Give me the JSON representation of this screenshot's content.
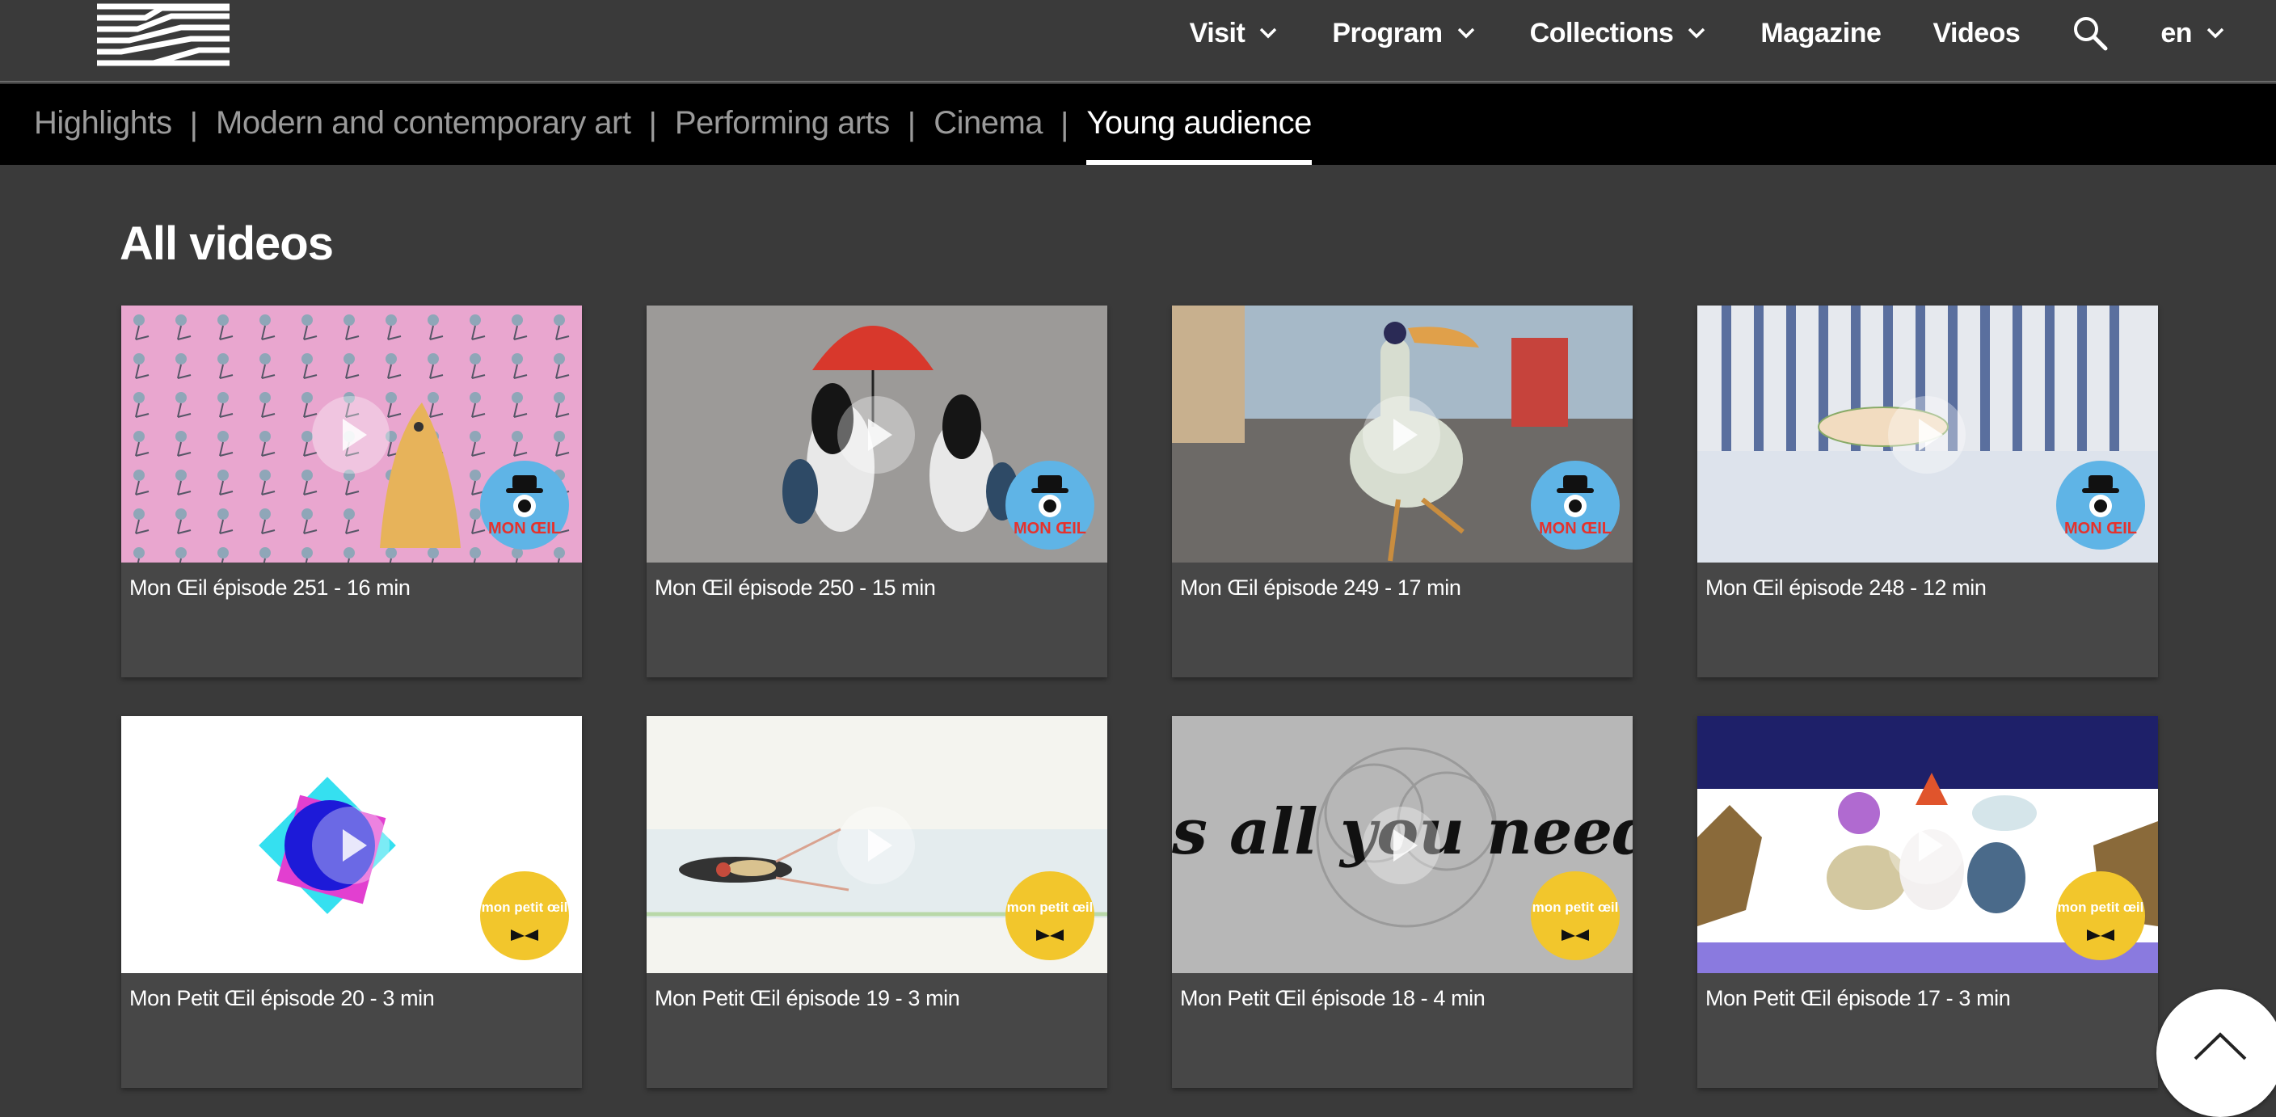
{
  "nav": {
    "items": [
      {
        "label": "Visit",
        "dropdown": true
      },
      {
        "label": "Program",
        "dropdown": true
      },
      {
        "label": "Collections",
        "dropdown": true
      },
      {
        "label": "Magazine",
        "dropdown": false
      },
      {
        "label": "Videos",
        "dropdown": false
      }
    ],
    "search_icon": "search-icon",
    "language": "en"
  },
  "subnav": {
    "items": [
      "Highlights",
      "Modern and contemporary art",
      "Performing arts",
      "Cinema",
      "Young audience"
    ],
    "separator": "|",
    "active": "Young audience"
  },
  "main": {
    "title": "All videos",
    "videos": [
      {
        "title": "Mon Œil épisode 251 - 16 min",
        "badge": "MON ŒIL"
      },
      {
        "title": "Mon Œil épisode 250 - 15 min",
        "badge": "MON ŒIL"
      },
      {
        "title": "Mon Œil épisode 249 - 17 min",
        "badge": "MON ŒIL"
      },
      {
        "title": "Mon Œil épisode 248 - 12 min",
        "badge": "MON ŒIL"
      },
      {
        "title": "Mon Petit Œil épisode 20 - 3 min",
        "badge": "mon petit œil"
      },
      {
        "title": "Mon Petit Œil épisode 19 - 3 min",
        "badge": "mon petit œil"
      },
      {
        "title": "Mon Petit Œil épisode 18 - 4 min",
        "badge": "mon petit œil",
        "thumb_text": "is all you need"
      },
      {
        "title": "Mon Petit Œil épisode 17 - 3 min",
        "badge": "mon petit œil"
      }
    ]
  },
  "colors": {
    "page_bg": "#3a3a3a",
    "subnav_bg": "#000000",
    "card_bg": "#474747",
    "badge_blue": "#5fb4e6",
    "badge_yellow": "#f2c62c"
  }
}
